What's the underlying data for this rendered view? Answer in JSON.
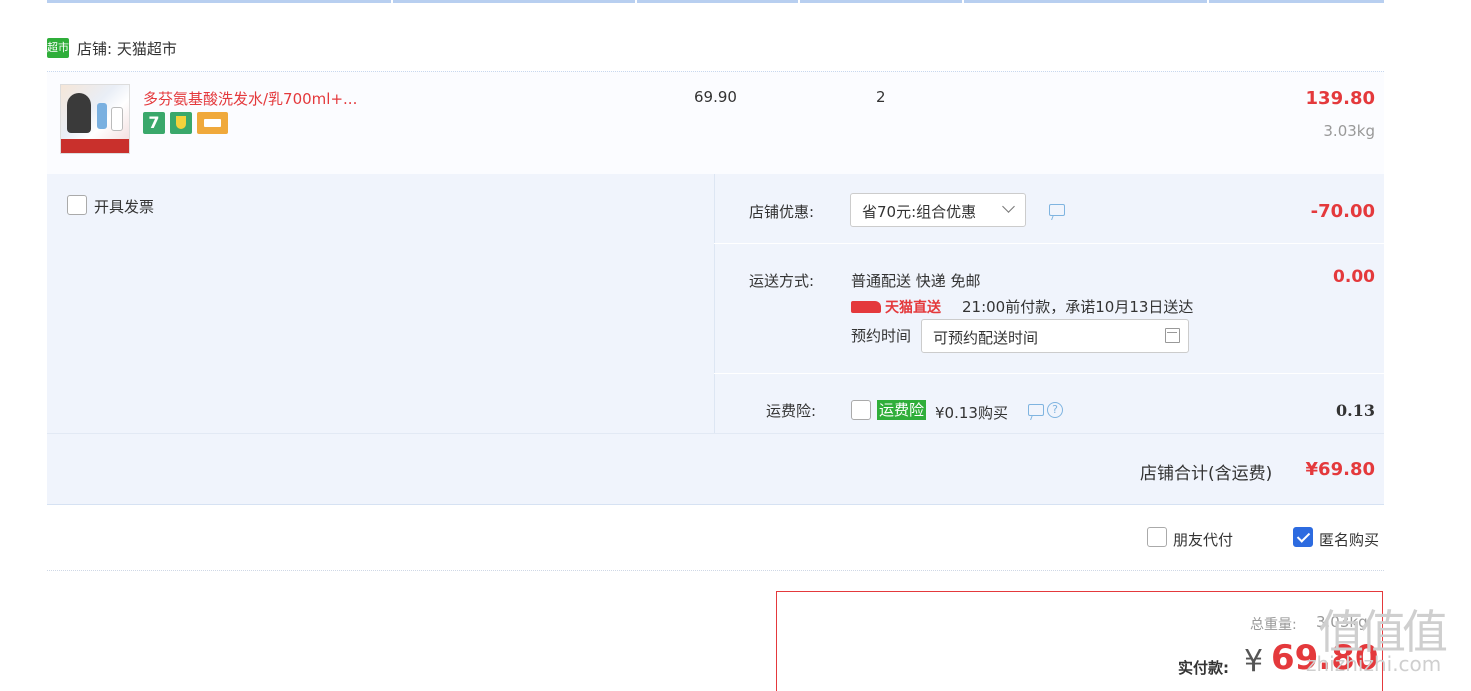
{
  "shop": {
    "icon_text": "超市",
    "label": "店铺:",
    "name": "天猫超市"
  },
  "item": {
    "title": "多芬氨基酸洗发水/乳700ml+...",
    "badge_seven": "7",
    "price": "69.90",
    "quantity": "2",
    "subtotal": "139.80",
    "weight": "3.03kg"
  },
  "invoice": {
    "label": "开具发票"
  },
  "discount": {
    "label": "店铺优惠:",
    "selected": "省70元:组合优惠",
    "amount": "-70.00"
  },
  "delivery": {
    "label": "运送方式:",
    "method": "普通配送 快递 免邮",
    "tmall_tag": "天猫直送",
    "promise": "21:00前付款，承诺10月13日送达",
    "appointment_label": "预约时间",
    "appointment_value": "可预约配送时间",
    "amount": "0.00"
  },
  "insurance": {
    "label": "运费险:",
    "tag": "运费险",
    "price_text": "¥0.13购买",
    "amount": "0.13",
    "help": "?"
  },
  "shop_total": {
    "label": "店铺合计(含运费)",
    "amount": "¥69.80"
  },
  "options": {
    "friend_pay": "朋友代付",
    "anonymous": "匿名购买"
  },
  "summary": {
    "weight_label": "总重量:",
    "weight_value": "3.03kg",
    "pay_label": "实付款:",
    "currency": "¥",
    "pay_amount": "69.80"
  },
  "watermark": {
    "glyphs": "值值值",
    "site": "zhizhizhi.com"
  },
  "colors": {
    "accent_red": "#e4393c",
    "tmall_green": "#2fae3a",
    "check_blue": "#2d6be0",
    "panel_bg": "#f0f4fc"
  }
}
